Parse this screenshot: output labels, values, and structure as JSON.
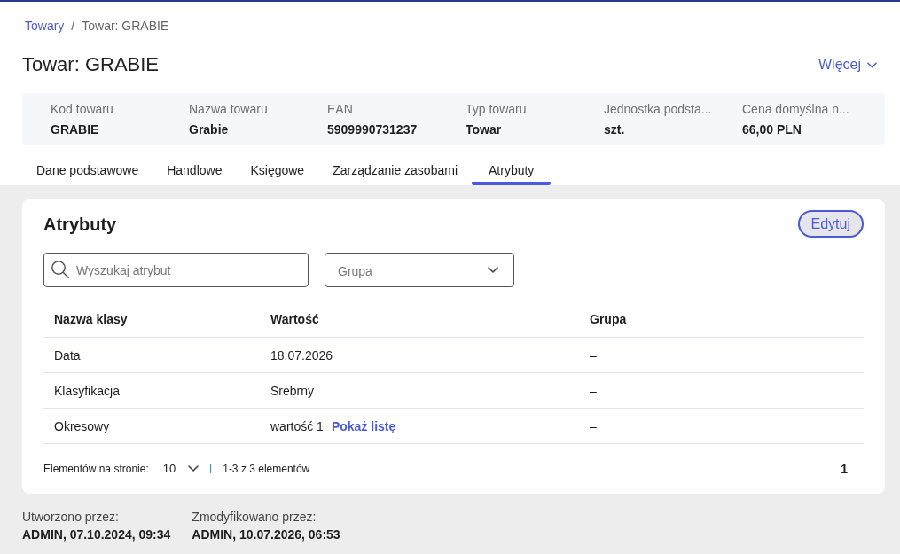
{
  "breadcrumb": {
    "separator": "/",
    "items": [
      {
        "label": "Towary",
        "link": true
      },
      {
        "label": "Towar: GRABIE",
        "link": false
      }
    ]
  },
  "title": "Towar: GRABIE",
  "more_button": "Więcej",
  "summary": [
    {
      "label": "Kod towaru",
      "value": "GRABIE"
    },
    {
      "label": "Nazwa towaru",
      "value": "Grabie"
    },
    {
      "label": "EAN",
      "value": "5909990731237"
    },
    {
      "label": "Typ towaru",
      "value": "Towar"
    },
    {
      "label": "Jednostka podsta...",
      "value": "szt."
    },
    {
      "label": "Cena domyślna n...",
      "value": "66,00 PLN"
    }
  ],
  "tabs": [
    {
      "label": "Dane podstawowe",
      "selected": false
    },
    {
      "label": "Handlowe",
      "selected": false
    },
    {
      "label": "Księgowe",
      "selected": false
    },
    {
      "label": "Zarządzanie zasobami",
      "selected": false
    },
    {
      "label": "Atrybuty",
      "selected": true
    }
  ],
  "attributes_card": {
    "title": "Atrybuty",
    "edit_button": "Edytuj",
    "search": {
      "placeholder": "Wyszukaj atrybut"
    },
    "group_select": {
      "placeholder": "Grupa"
    },
    "table": {
      "columns": [
        "Nazwa klasy",
        "Wartość",
        "Grupa"
      ],
      "rows": [
        {
          "name": "Data",
          "value": "18.07.2026",
          "group": "–"
        },
        {
          "name": "Klasyfikacja",
          "value": "Srebrny",
          "group": "–"
        },
        {
          "name": "Okresowy",
          "value": "wartość 1",
          "value_link": "Pokaż listę",
          "group": "–"
        }
      ]
    },
    "pagination": {
      "page_size_label": "Elementów na stronie:",
      "page_size": "10",
      "range": "1-3 z 3 elementów",
      "pages": [
        {
          "label": "1",
          "selected": true
        }
      ]
    }
  },
  "footer": [
    {
      "label": "Utworzono przez:",
      "value": "ADMIN, 07.10.2024, 09:34"
    },
    {
      "label": "Zmodyfikowano przez:",
      "value": "ADMIN, 10.07.2026, 06:53"
    }
  ]
}
